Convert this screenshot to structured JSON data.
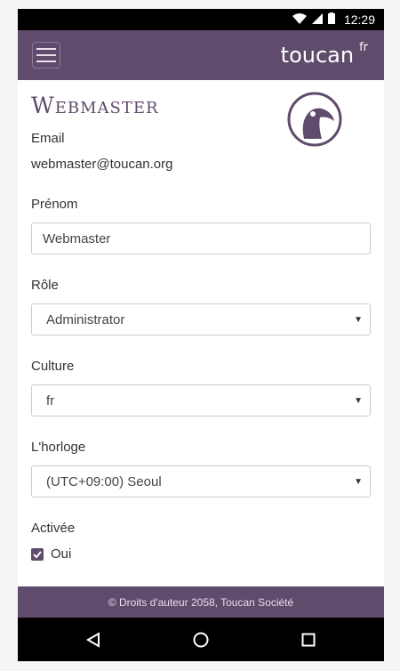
{
  "status": {
    "time": "12:29"
  },
  "header": {
    "brand": "toucan",
    "brand_suffix": "fr"
  },
  "page": {
    "title": "Webmaster"
  },
  "form": {
    "email_label": "Email",
    "email_value": "webmaster@toucan.org",
    "first_name_label": "Prénom",
    "first_name_value": "Webmaster",
    "role_label": "Rôle",
    "role_value": "Administrator",
    "culture_label": "Culture",
    "culture_value": "fr",
    "clock_label": "L'horloge",
    "clock_value": "(UTC+09:00) Seoul",
    "activated_label": "Activée",
    "activated_option_label": "Oui",
    "activated_checked": true
  },
  "footer": {
    "text": "© Droits d'auteur 2058, Toucan Société"
  },
  "colors": {
    "primary": "#5f4b6b"
  }
}
